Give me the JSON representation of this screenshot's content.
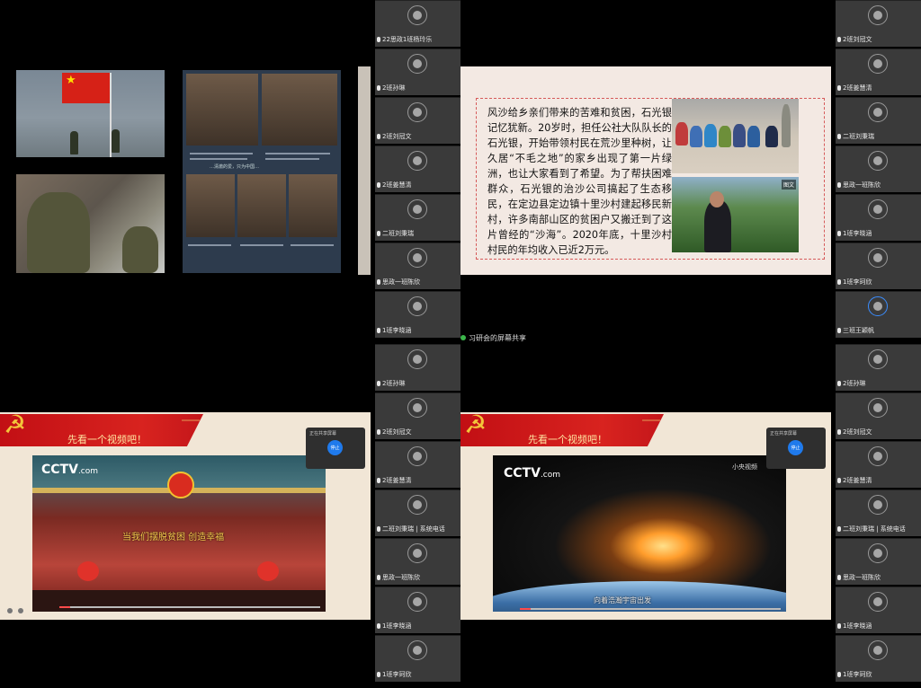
{
  "screen_share_label": "习研会的屏幕共享",
  "top_left": {
    "poster_caption": "…清澈的爱，只为中国…"
  },
  "top_right": {
    "paragraph": "风沙给乡亲们带来的苦难和贫困，石光银记忆犹新。20岁时，担任公社大队队长的石光银，开始带领村民在荒沙里种树，让久居“不毛之地”的家乡出现了第一片绿洲，也让大家看到了希望。为了帮扶困难群众，石光银的治沙公司搞起了生态移民，在定边县定边镇十里沙村建起移民新村，许多南部山区的贫困户又搬迁到了这片曾经的“沙海”。2020年底，十里沙村村民的年均收入已近2万元。",
    "photo_tag": "图文"
  },
  "bottom_left": {
    "banner_title": "先看一个视频吧！",
    "logo_main": "CCTV",
    "logo_sub": ".com",
    "subtitle": "当我们摆脱贫困  创造幸福",
    "toolbar_title": "正在共享屏幕",
    "toolbar_button": "停止"
  },
  "bottom_right": {
    "banner_title": "先看一个视频吧！",
    "logo_main": "CCTV",
    "logo_sub": ".com",
    "watermark": "小央视频",
    "subtitle": "向着浩瀚宇宙出发",
    "toolbar_title": "正在共享屏幕",
    "toolbar_button": "停止"
  },
  "strip_top_center": [
    "22思政1班杨玲乐",
    "2班孙琳",
    "2班刘冠文",
    "2班姜慧清",
    "二班刘秉瑞",
    "思政一班陈欣",
    "1班李晓涵"
  ],
  "strip_top_right": [
    "2班刘冠文",
    "2班姜慧清",
    "二班刘秉瑞",
    "思政一班陈欣",
    "1班李晓涵",
    "1班李珂欣",
    "三班王颖帆"
  ],
  "strip_bottom_center": [
    "2班孙琳",
    "2班刘冠文",
    "2班姜慧清",
    "二班刘秉瑞 | 系统电话",
    "思政一班陈欣",
    "1班李晓涵",
    "1班李珂欣"
  ],
  "strip_bottom_right": [
    "2班孙琳",
    "2班刘冠文",
    "2班姜慧清",
    "二班刘秉瑞 | 系统电话",
    "思政一班陈欣",
    "1班李晓涵",
    "1班李珂欣"
  ],
  "colors": {
    "party_red": "#c20f14",
    "banner_gold": "#f3c53a",
    "slide_bg": "#f1e6d6"
  }
}
